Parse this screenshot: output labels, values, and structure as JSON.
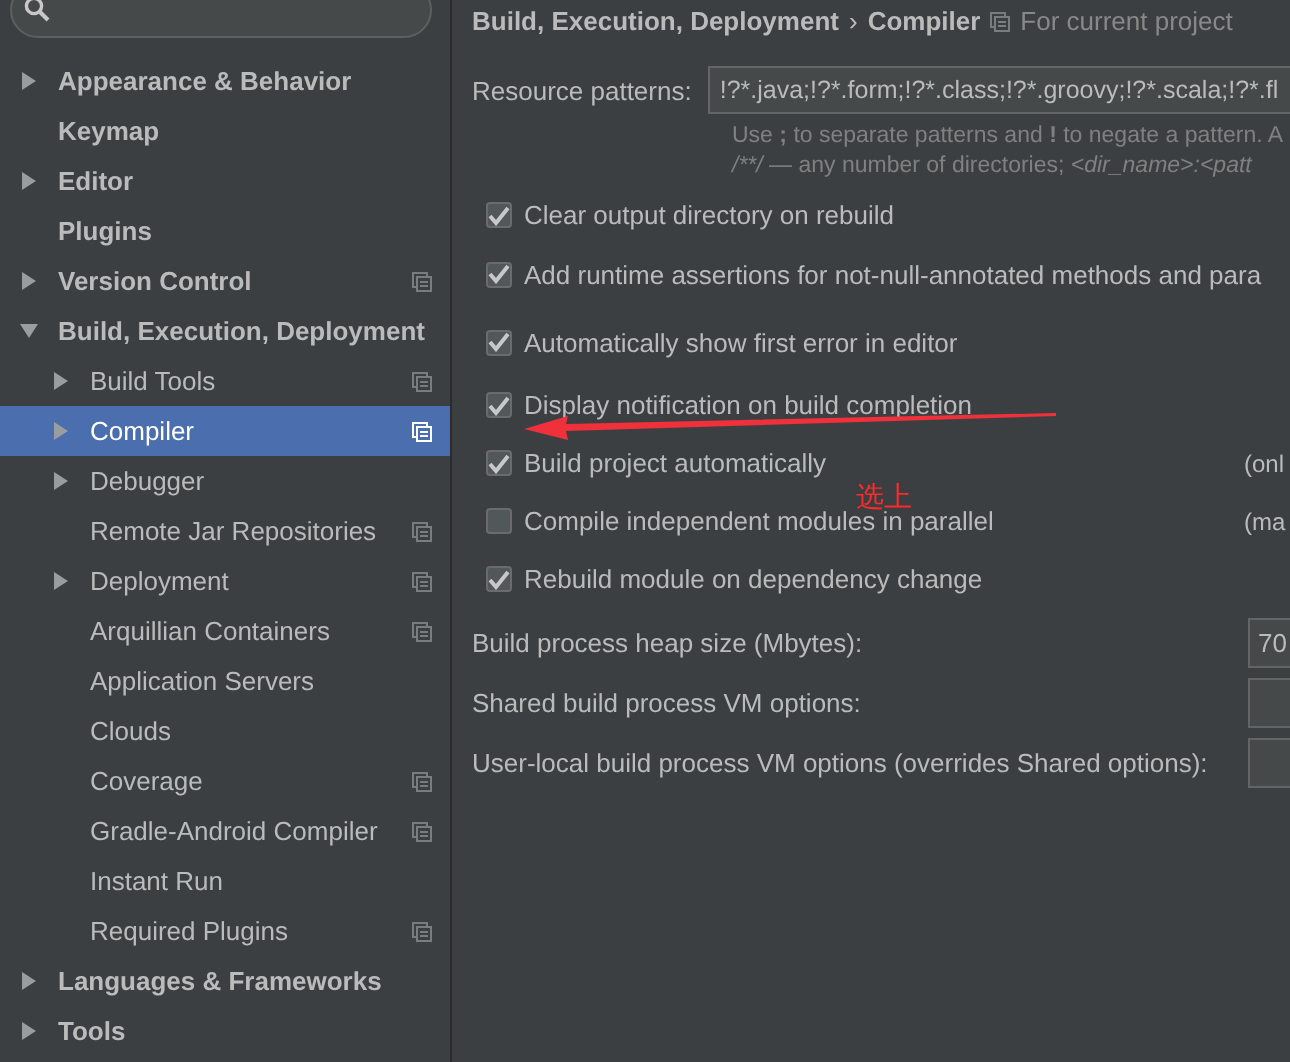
{
  "sidebar": {
    "items": [
      {
        "label": "Appearance & Behavior",
        "kind": "group",
        "expanded": false,
        "selected": false,
        "project_scope": false
      },
      {
        "label": "Keymap",
        "kind": "leaf",
        "selected": false,
        "project_scope": false
      },
      {
        "label": "Editor",
        "kind": "group",
        "expanded": false,
        "selected": false,
        "project_scope": false
      },
      {
        "label": "Plugins",
        "kind": "leaf",
        "selected": false,
        "project_scope": false
      },
      {
        "label": "Version Control",
        "kind": "group",
        "expanded": false,
        "selected": false,
        "project_scope": true
      },
      {
        "label": "Build, Execution, Deployment",
        "kind": "group",
        "expanded": true,
        "selected": false,
        "project_scope": false,
        "children": [
          {
            "label": "Build Tools",
            "kind": "group",
            "expanded": false,
            "selected": false,
            "project_scope": true
          },
          {
            "label": "Compiler",
            "kind": "group",
            "expanded": false,
            "selected": true,
            "project_scope": true
          },
          {
            "label": "Debugger",
            "kind": "group",
            "expanded": false,
            "selected": false,
            "project_scope": false
          },
          {
            "label": "Remote Jar Repositories",
            "kind": "leaf",
            "selected": false,
            "project_scope": true
          },
          {
            "label": "Deployment",
            "kind": "group",
            "expanded": false,
            "selected": false,
            "project_scope": true
          },
          {
            "label": "Arquillian Containers",
            "kind": "leaf",
            "selected": false,
            "project_scope": true
          },
          {
            "label": "Application Servers",
            "kind": "leaf",
            "selected": false,
            "project_scope": false
          },
          {
            "label": "Clouds",
            "kind": "leaf",
            "selected": false,
            "project_scope": false
          },
          {
            "label": "Coverage",
            "kind": "leaf",
            "selected": false,
            "project_scope": true
          },
          {
            "label": "Gradle-Android Compiler",
            "kind": "leaf",
            "selected": false,
            "project_scope": true
          },
          {
            "label": "Instant Run",
            "kind": "leaf",
            "selected": false,
            "project_scope": false
          },
          {
            "label": "Required Plugins",
            "kind": "leaf",
            "selected": false,
            "project_scope": true
          }
        ]
      },
      {
        "label": "Languages & Frameworks",
        "kind": "group",
        "expanded": false,
        "selected": false,
        "project_scope": false
      },
      {
        "label": "Tools",
        "kind": "group",
        "expanded": false,
        "selected": false,
        "project_scope": false
      }
    ]
  },
  "breadcrumb": {
    "parent": "Build, Execution, Deployment",
    "separator": "›",
    "current": "Compiler",
    "scope": "For current project"
  },
  "resource_patterns": {
    "label": "Resource patterns:",
    "value": "!?*.java;!?*.form;!?*.class;!?*.groovy;!?*.scala;!?*.fl",
    "hint": "Use **;** to separate patterns and **!** to negate a pattern. A",
    "hint_2_parts": [
      "/**/",
      " — any number of directories; ",
      "<dir_name>:<patt"
    ]
  },
  "options": [
    {
      "label": "Clear output directory on rebuild",
      "checked": true
    },
    {
      "label": "Add runtime assertions for not-null-annotated methods and para",
      "checked": true
    },
    {
      "label": "Automatically show first error in editor",
      "checked": true
    },
    {
      "label": "Display notification on build completion",
      "checked": true
    },
    {
      "label": "Build project automatically",
      "checked": true,
      "note": "(onl"
    },
    {
      "label": "Compile independent modules in parallel",
      "checked": false,
      "note": "(ma"
    },
    {
      "label": "Rebuild module on dependency change",
      "checked": true
    }
  ],
  "vm_fields": [
    {
      "label": "Build process heap size (Mbytes):",
      "value": "70"
    },
    {
      "label": "Shared build process VM options:"
    },
    {
      "label": "User-local build process VM options (overrides Shared options):"
    }
  ],
  "annotation": {
    "text": "选上"
  }
}
